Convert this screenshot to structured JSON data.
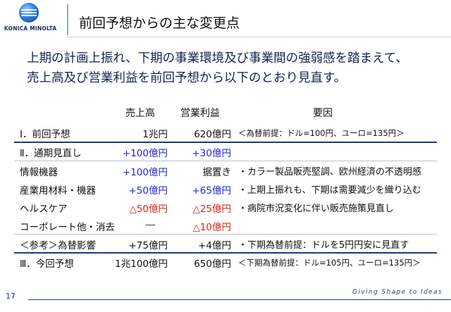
{
  "brand": {
    "logo_text": "KONICA MINOLTA"
  },
  "header": {
    "title": "前回予想からの主な変更点"
  },
  "lead": {
    "line1": "上期の計画上振れ、下期の事業環境及び事業間の強弱感を踏まえて、",
    "line2": "売上高及び営業利益を前回予想から以下のとおり見直す。"
  },
  "table": {
    "headers": {
      "sales": "売上高",
      "operating_profit": "営業利益",
      "reason": "要因"
    },
    "rows": [
      {
        "label": "Ⅰ．前回予想",
        "sales": "1兆円",
        "op": "620億円",
        "reason": "＜為替前提：ドル=100円、ユーロ=135円＞"
      },
      {
        "label": "Ⅱ．通期見直し",
        "sales": "+100億円",
        "op": "+30億円",
        "reason": ""
      },
      {
        "label": "情報機器",
        "sales": "+100億円",
        "op": "据置き",
        "reason": "カラー製品販売堅調、欧州経済の不透明感"
      },
      {
        "label": "産業用材料・機器",
        "sales": "+50億円",
        "op": "+65億円",
        "reason": "上期上振れも、下期は需要減少を織り込む"
      },
      {
        "label": "ヘルスケア",
        "sales": "△50億円",
        "op": "△25億円",
        "reason": "病院市況変化に伴い販売施策見直し"
      },
      {
        "label": "コーポレート他・消去",
        "sales": "―",
        "op": "△10億円",
        "reason": ""
      },
      {
        "label": "＜参考＞為替影響",
        "sales": "+75億円",
        "op": "+4億円",
        "reason": "下期為替前提：ドルを5円円安に見直す"
      },
      {
        "label": "Ⅲ．今回予想",
        "sales": "1兆100億円",
        "op": "650億円",
        "reason": "＜下期為替前提：ドル=105円、ユーロ=135円＞"
      }
    ]
  },
  "colors": {
    "positive": "#1f25d6",
    "negative": "#d9231d",
    "navy": "#1e3a78"
  },
  "footer": {
    "page_number": "17",
    "tagline": "Giving Shape to Ideas"
  }
}
